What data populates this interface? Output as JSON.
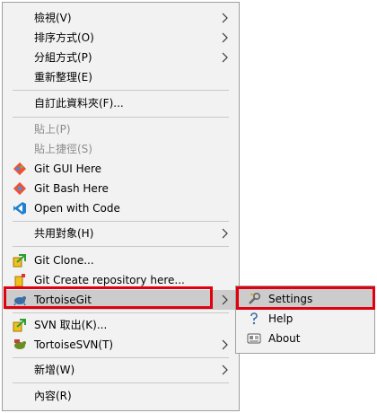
{
  "context_menu": {
    "items": [
      {
        "label": "檢視(V)",
        "icon": "",
        "has_submenu": true,
        "disabled": false
      },
      {
        "label": "排序方式(O)",
        "icon": "",
        "has_submenu": true,
        "disabled": false
      },
      {
        "label": "分組方式(P)",
        "icon": "",
        "has_submenu": true,
        "disabled": false
      },
      {
        "label": "重新整理(E)",
        "icon": "",
        "has_submenu": false,
        "disabled": false
      },
      {
        "label": "自訂此資料夾(F)...",
        "icon": "",
        "has_submenu": false,
        "disabled": false
      },
      {
        "label": "貼上(P)",
        "icon": "",
        "has_submenu": false,
        "disabled": true
      },
      {
        "label": "貼上捷徑(S)",
        "icon": "",
        "has_submenu": false,
        "disabled": true
      },
      {
        "label": "Git GUI Here",
        "icon": "git-gui-icon",
        "has_submenu": false,
        "disabled": false
      },
      {
        "label": "Git Bash Here",
        "icon": "git-bash-icon",
        "has_submenu": false,
        "disabled": false
      },
      {
        "label": "Open with Code",
        "icon": "vscode-icon",
        "has_submenu": false,
        "disabled": false
      },
      {
        "label": "共用對象(H)",
        "icon": "",
        "has_submenu": true,
        "disabled": false
      },
      {
        "label": "Git Clone...",
        "icon": "git-clone-icon",
        "has_submenu": false,
        "disabled": false
      },
      {
        "label": "Git Create repository here...",
        "icon": "git-create-repo-icon",
        "has_submenu": false,
        "disabled": false
      },
      {
        "label": "TortoiseGit",
        "icon": "tortoisegit-icon",
        "has_submenu": true,
        "disabled": false,
        "highlighted": true
      },
      {
        "label": "SVN 取出(K)...",
        "icon": "svn-checkout-icon",
        "has_submenu": false,
        "disabled": false
      },
      {
        "label": "TortoiseSVN(T)",
        "icon": "tortoisesvn-icon",
        "has_submenu": true,
        "disabled": false
      },
      {
        "label": "新增(W)",
        "icon": "",
        "has_submenu": true,
        "disabled": false
      },
      {
        "label": "內容(R)",
        "icon": "",
        "has_submenu": false,
        "disabled": false
      }
    ]
  },
  "submenu": {
    "items": [
      {
        "label": "Settings",
        "icon": "settings-wrench-icon",
        "highlighted": true
      },
      {
        "label": "Help",
        "icon": "help-icon"
      },
      {
        "label": "About",
        "icon": "about-icon"
      }
    ]
  },
  "colors": {
    "menu_bg": "#f2f2f2",
    "highlight": "#cccccc",
    "annotation_red": "#e0000f",
    "disabled_text": "#8c8c8c"
  }
}
